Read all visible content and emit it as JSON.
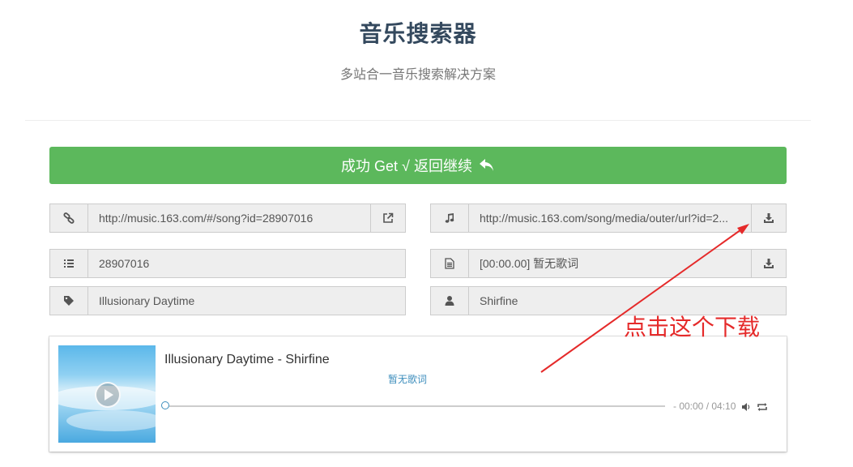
{
  "header": {
    "title": "音乐搜索器",
    "subtitle": "多站合一音乐搜索解决方案"
  },
  "success_button": {
    "label": "成功 Get √ 返回继续",
    "icon": "reply-icon"
  },
  "fields": {
    "link": {
      "icon": "link-icon",
      "value": "http://music.163.com/#/song?id=28907016",
      "action_icon": "external-link-icon"
    },
    "music_url": {
      "icon": "music-icon",
      "value": "http://music.163.com/song/media/outer/url?id=2...",
      "action_icon": "download-icon"
    },
    "song_id": {
      "icon": "list-icon",
      "value": "28907016"
    },
    "lyrics": {
      "icon": "file-icon",
      "value": "[00:00.00] 暂无歌词",
      "action_icon": "download-icon"
    },
    "song_name": {
      "icon": "tag-icon",
      "value": "Illusionary Daytime"
    },
    "artist": {
      "icon": "user-icon",
      "value": "Shirfine"
    }
  },
  "player": {
    "title": "Illusionary Daytime - Shirfine",
    "lyric": "暂无歌词",
    "time": "- 00:00 / 04:10",
    "progress": 0,
    "cover_icon": "album-cover",
    "play_icon": "play-icon",
    "volume_icon": "volume-icon",
    "loop_icon": "loop-icon"
  },
  "annotation": {
    "text": "点击这个下载",
    "color": "#e52a2a"
  },
  "colors": {
    "success": "#5cb85c",
    "title": "#34495e",
    "accent": "#3c8dbc"
  }
}
